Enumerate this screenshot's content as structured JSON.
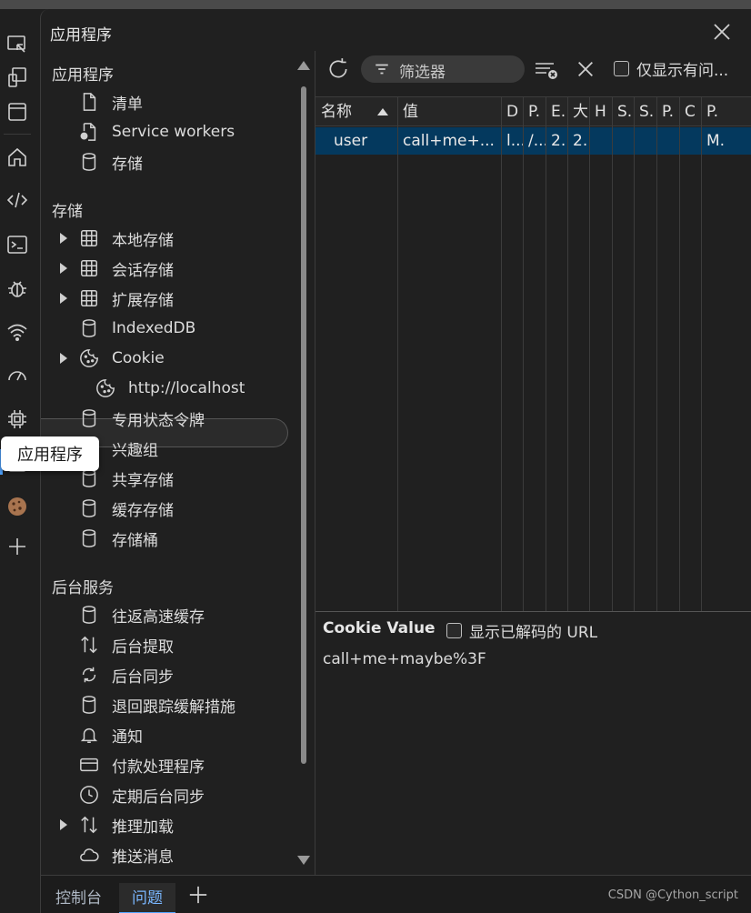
{
  "panel": {
    "title": "应用程序"
  },
  "tree": {
    "section_app": "应用程序",
    "app_items": [
      {
        "label": "清单",
        "icon": "document-icon"
      },
      {
        "label": "Service workers",
        "icon": "gear-document-icon"
      },
      {
        "label": "存储",
        "icon": "database-icon"
      }
    ],
    "section_storage": "存储",
    "storage_items": [
      {
        "label": "本地存储",
        "icon": "table-icon",
        "expandable": true
      },
      {
        "label": "会话存储",
        "icon": "table-icon",
        "expandable": true
      },
      {
        "label": "扩展存储",
        "icon": "table-icon",
        "expandable": true
      },
      {
        "label": "IndexedDB",
        "icon": "database-icon"
      },
      {
        "label": "Cookie",
        "icon": "cookie-icon",
        "expandable": true
      },
      {
        "label": "http://localhost",
        "icon": "cookie-icon",
        "selected": true
      },
      {
        "label": "专用状态令牌",
        "icon": "database-icon"
      },
      {
        "label": "兴趣组",
        "icon": "database-icon"
      },
      {
        "label": "共享存储",
        "icon": "database-icon"
      },
      {
        "label": "缓存存储",
        "icon": "database-icon"
      },
      {
        "label": "存储桶",
        "icon": "database-icon"
      }
    ],
    "section_background": "后台服务",
    "background_items": [
      {
        "label": "往返高速缓存",
        "icon": "database-icon"
      },
      {
        "label": "后台提取",
        "icon": "up-down-arrows-icon"
      },
      {
        "label": "后台同步",
        "icon": "sync-icon"
      },
      {
        "label": "退回跟踪缓解措施",
        "icon": "database-icon"
      },
      {
        "label": "通知",
        "icon": "bell-icon"
      },
      {
        "label": "付款处理程序",
        "icon": "card-icon"
      },
      {
        "label": "定期后台同步",
        "icon": "clock-icon"
      },
      {
        "label": "推理加载",
        "icon": "up-down-arrows-icon",
        "expandable": true
      },
      {
        "label": "推送消息",
        "icon": "cloud-icon"
      }
    ]
  },
  "tooltip": "应用程序",
  "toolbar": {
    "filter_placeholder": "筛选器",
    "only_issues_label": "仅显示有问..."
  },
  "grid": {
    "columns": [
      "名称",
      "值",
      "D",
      "P.",
      "E.",
      "大",
      "H",
      "S.",
      "S.",
      "P.",
      "C",
      "P."
    ],
    "rows": [
      [
        "user",
        "call+me+...",
        "l...",
        "/...",
        "2...",
        "2...",
        "",
        "",
        "",
        "",
        "",
        "M."
      ]
    ]
  },
  "detail": {
    "title": "Cookie Value",
    "decode_label": "显示已解码的 URL",
    "value": "call+me+maybe%3F"
  },
  "bottom_tabs": [
    "控制台",
    "问题"
  ],
  "watermark": "CSDN @Cython_script",
  "colors": {
    "selection": "#04395e",
    "accent": "#4fa3ff",
    "background": "#202020"
  }
}
